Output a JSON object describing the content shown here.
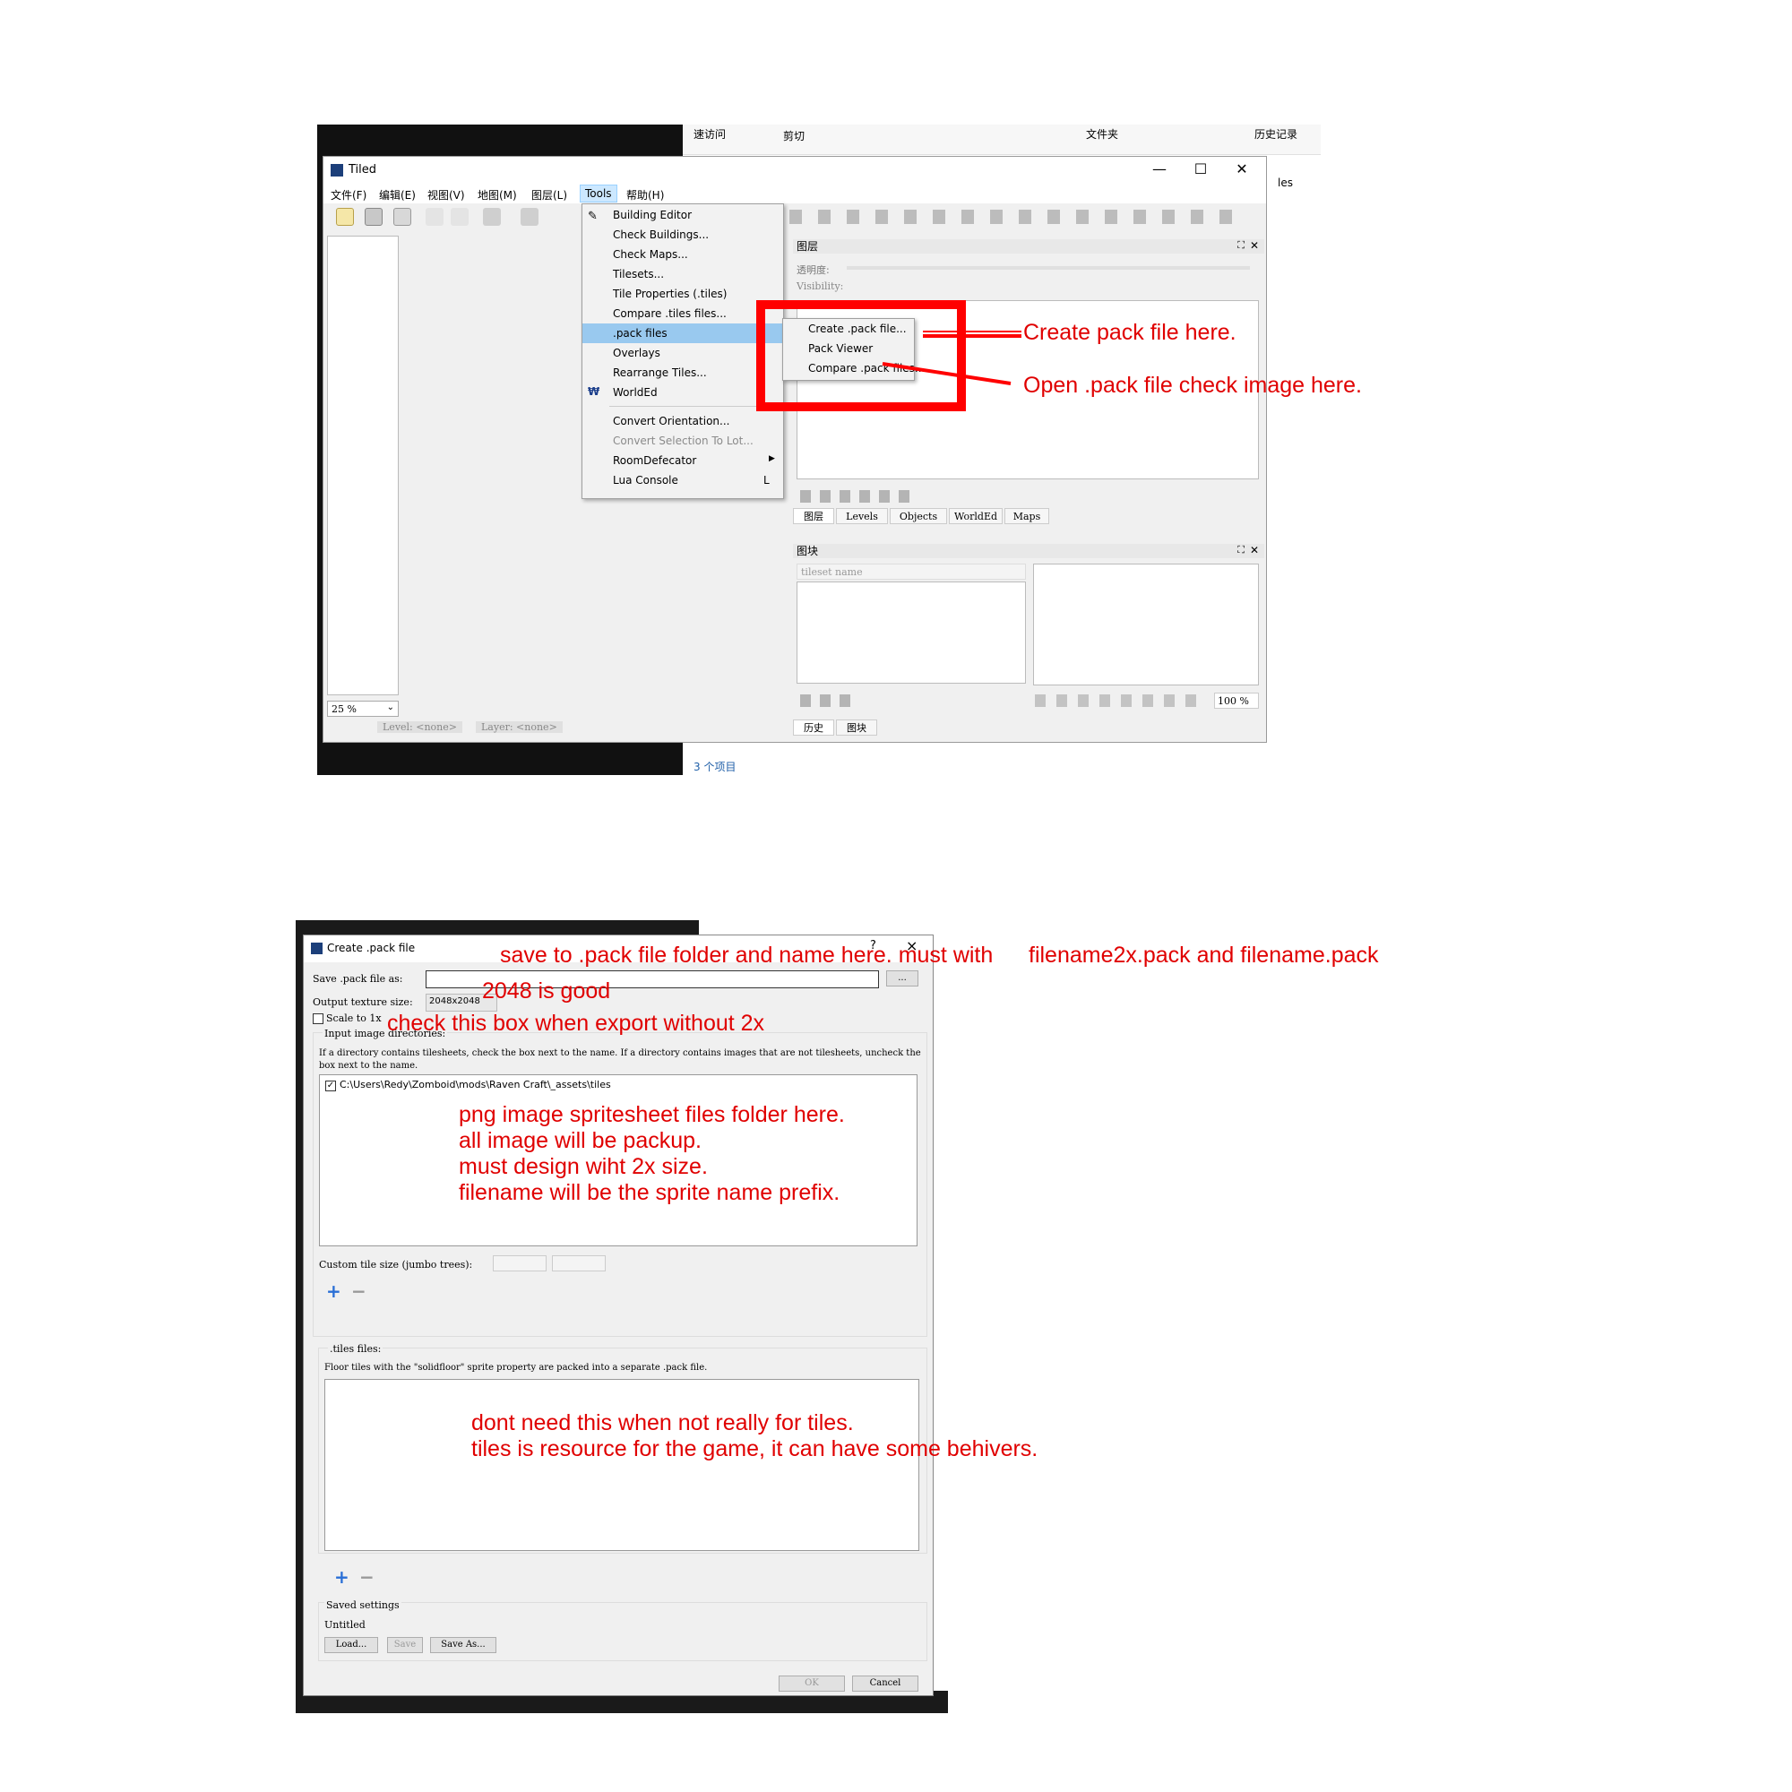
{
  "tiled": {
    "title": "Tiled",
    "menubar": [
      "文件(F)",
      "编辑(E)",
      "视图(V)",
      "地图(M)",
      "图层(L)",
      "Tools",
      "帮助(H)"
    ],
    "tools_menu": [
      "Building Editor",
      "Check Buildings...",
      "Check Maps...",
      "Tilesets...",
      "Tile Properties (.tiles)",
      "Compare .tiles files...",
      ".pack files",
      "Overlays",
      "Rearrange Tiles...",
      "WorldEd",
      "Convert Orientation...",
      "Convert Selection To Lot...",
      "RoomDefecator",
      "Lua Console"
    ],
    "lua_shortcut": "L",
    "pack_submenu": [
      "Create .pack file...",
      "Pack Viewer",
      "Compare .pack files..."
    ],
    "layers_panel": {
      "title": "图层",
      "opacity_label": "透明度:",
      "visibility_label": "Visibility:",
      "tabs": [
        "图层",
        "Levels",
        "Objects",
        "WorldEd",
        "Maps"
      ]
    },
    "tileset_panel": {
      "title": "图块",
      "placeholder": "tileset name",
      "zoom": "100 %",
      "tabs": [
        "历史",
        "图块"
      ]
    },
    "zoom": "25 %",
    "status_level": "Level: <none>",
    "status_layer": "Layer: <none>"
  },
  "explorer": {
    "quick_access": "速访问",
    "cut": "剪切",
    "folder": "文件夹",
    "history": "历史记录",
    "partial": "les",
    "items": "3 个项目"
  },
  "dialog": {
    "title": "Create .pack file",
    "help": "?",
    "close": "×",
    "save_label": "Save .pack file as:",
    "save_value": "",
    "browse": "...",
    "texture_label": "Output texture size:",
    "texture_value": "2048x2048",
    "scale_label": "Scale to 1x",
    "input_dirs_label": "Input image directories:",
    "input_dirs_help": "If a directory contains tilesheets, check the box next to the name.  If a directory contains images that are not tilesheets, uncheck the box next to the name.",
    "dir_entry": "C:\\Users\\Redy\\Zomboid\\mods\\Raven Craft\\_assets\\tiles",
    "custom_tile_label": "Custom tile size (jumbo trees):",
    "tiles_files_label": ".tiles files:",
    "tiles_files_help": "Floor tiles with the \"solidfloor\" sprite property are packed into a separate .pack file.",
    "saved_settings_label": "Saved settings",
    "saved_settings_value": "Untitled",
    "load": "Load...",
    "save": "Save",
    "save_as": "Save As...",
    "ok": "OK",
    "cancel": "Cancel"
  },
  "annotations": {
    "create_pack": "Create pack file here.",
    "open_pack": "Open .pack file check image here.",
    "save_to": "save to .pack file folder and name here. must with",
    "filenames": "filename2x.pack and filename.pack",
    "size_good": "2048 is good",
    "check_box": "check this box when export without 2x",
    "png_lines": [
      "png image spritesheet files folder here.",
      "all image will be packup.",
      "must design wiht 2x size.",
      "filename will be the sprite name prefix."
    ],
    "tiles_lines": [
      "dont need this when not really for tiles.",
      "tiles is resource for the game, it can have some behivers."
    ]
  },
  "colors": {
    "annotation": "#e00000",
    "highlight": "#99c9ef",
    "window_bg": "#f0f0f0"
  }
}
